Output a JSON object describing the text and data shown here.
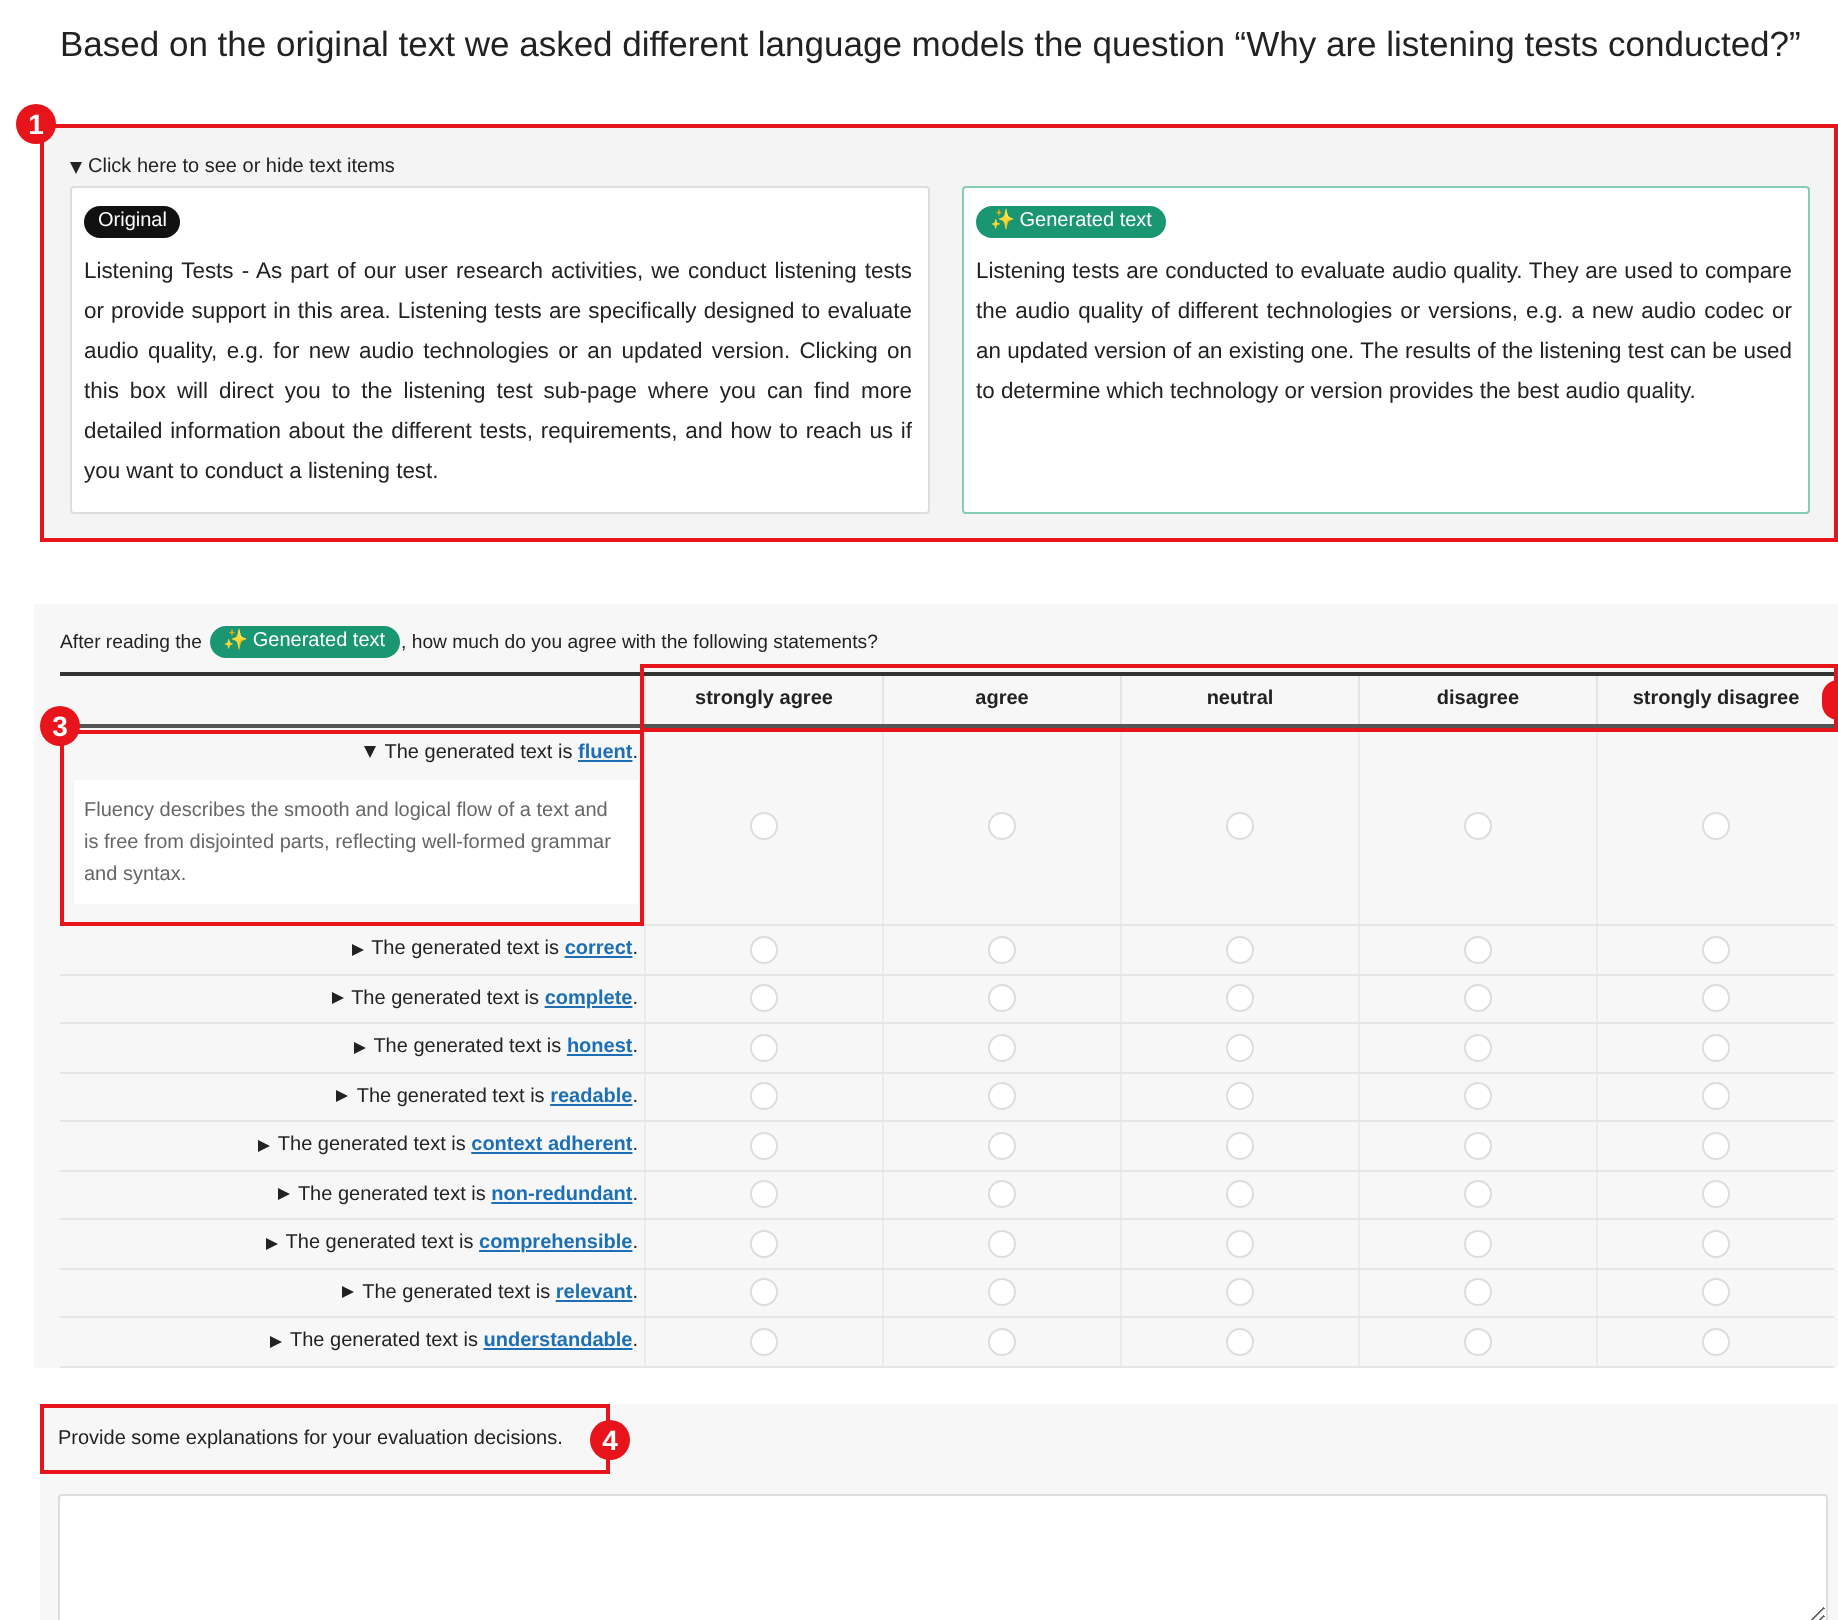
{
  "heading": "Based on the original text we asked different language models the question “Why are listening tests conducted?”",
  "text_section": {
    "highlight": {
      "kind": "full",
      "number": "1"
    },
    "toggle": {
      "label": "Click here to see or hide text items",
      "expanded": true
    },
    "cards": [
      {
        "kind": "original",
        "badge": "Original",
        "text": "Listening Tests - As part of our user research activities, we conduct listening tests or provide support in this area. Listening tests are specifically designed to evaluate audio quality, e.g. for new audio technologies or an updated version. Clicking on this box will direct you to the listening test sub-page where you can find more detailed information about the different tests, requirements, and how to reach us if you want to conduct a listening test."
      },
      {
        "kind": "generated",
        "badge": "✨ Generated text",
        "text": "Listening tests are conducted to evaluate audio quality. They are used to compare the audio quality of different technologies or versions, e.g. a new audio codec or an updated version of an existing one. The results of the listening test can be used to determine which technology or version provides the best audio quality."
      }
    ]
  },
  "survey": {
    "prompt_before": "After reading the",
    "prompt_badge": "✨ Generated text",
    "prompt_after": ", how much do you agree with the following statements?",
    "columns": [
      "strongly agree",
      "agree",
      "neutral",
      "disagree",
      "strongly disagree"
    ],
    "header_highlight": {
      "kind": "partial"
    },
    "rows": [
      {
        "prefix": "The generated text is ",
        "term": "fluent",
        "suffix": ".",
        "expanded": true,
        "description": "Fluency describes the smooth and logical flow of a text and is free from disjointed parts, reflecting well-formed grammar and syntax.",
        "highlight": {
          "kind": "full",
          "number": "3"
        },
        "options": [
          false,
          false,
          false,
          false,
          false
        ]
      },
      {
        "prefix": "The generated text is ",
        "term": "correct",
        "suffix": ".",
        "expanded": false,
        "options": [
          false,
          false,
          false,
          false,
          false
        ]
      },
      {
        "prefix": "The generated text is ",
        "term": "complete",
        "suffix": ".",
        "expanded": false,
        "options": [
          false,
          false,
          false,
          false,
          false
        ]
      },
      {
        "prefix": "The generated text is ",
        "term": "honest",
        "suffix": ".",
        "expanded": false,
        "options": [
          false,
          false,
          false,
          false,
          false
        ]
      },
      {
        "prefix": "The generated text is ",
        "term": "readable",
        "suffix": ".",
        "expanded": false,
        "options": [
          false,
          false,
          false,
          false,
          false
        ]
      },
      {
        "prefix": "The generated text is ",
        "term": "context adherent",
        "suffix": ".",
        "expanded": false,
        "options": [
          false,
          false,
          false,
          false,
          false
        ]
      },
      {
        "prefix": "The generated text is ",
        "term": "non-redundant",
        "suffix": ".",
        "expanded": false,
        "options": [
          false,
          false,
          false,
          false,
          false
        ]
      },
      {
        "prefix": "The generated text is ",
        "term": "comprehensible",
        "suffix": ".",
        "expanded": false,
        "options": [
          false,
          false,
          false,
          false,
          false
        ]
      },
      {
        "prefix": "The generated text is ",
        "term": "relevant",
        "suffix": ".",
        "expanded": false,
        "options": [
          false,
          false,
          false,
          false,
          false
        ]
      },
      {
        "prefix": "The generated text is ",
        "term": "understandable",
        "suffix": ".",
        "expanded": false,
        "options": [
          false,
          false,
          false,
          false,
          false
        ]
      }
    ]
  },
  "explanation": {
    "label": "Provide some explanations for your evaluation decisions.",
    "highlight": {
      "kind": "full",
      "number": "4"
    }
  }
}
